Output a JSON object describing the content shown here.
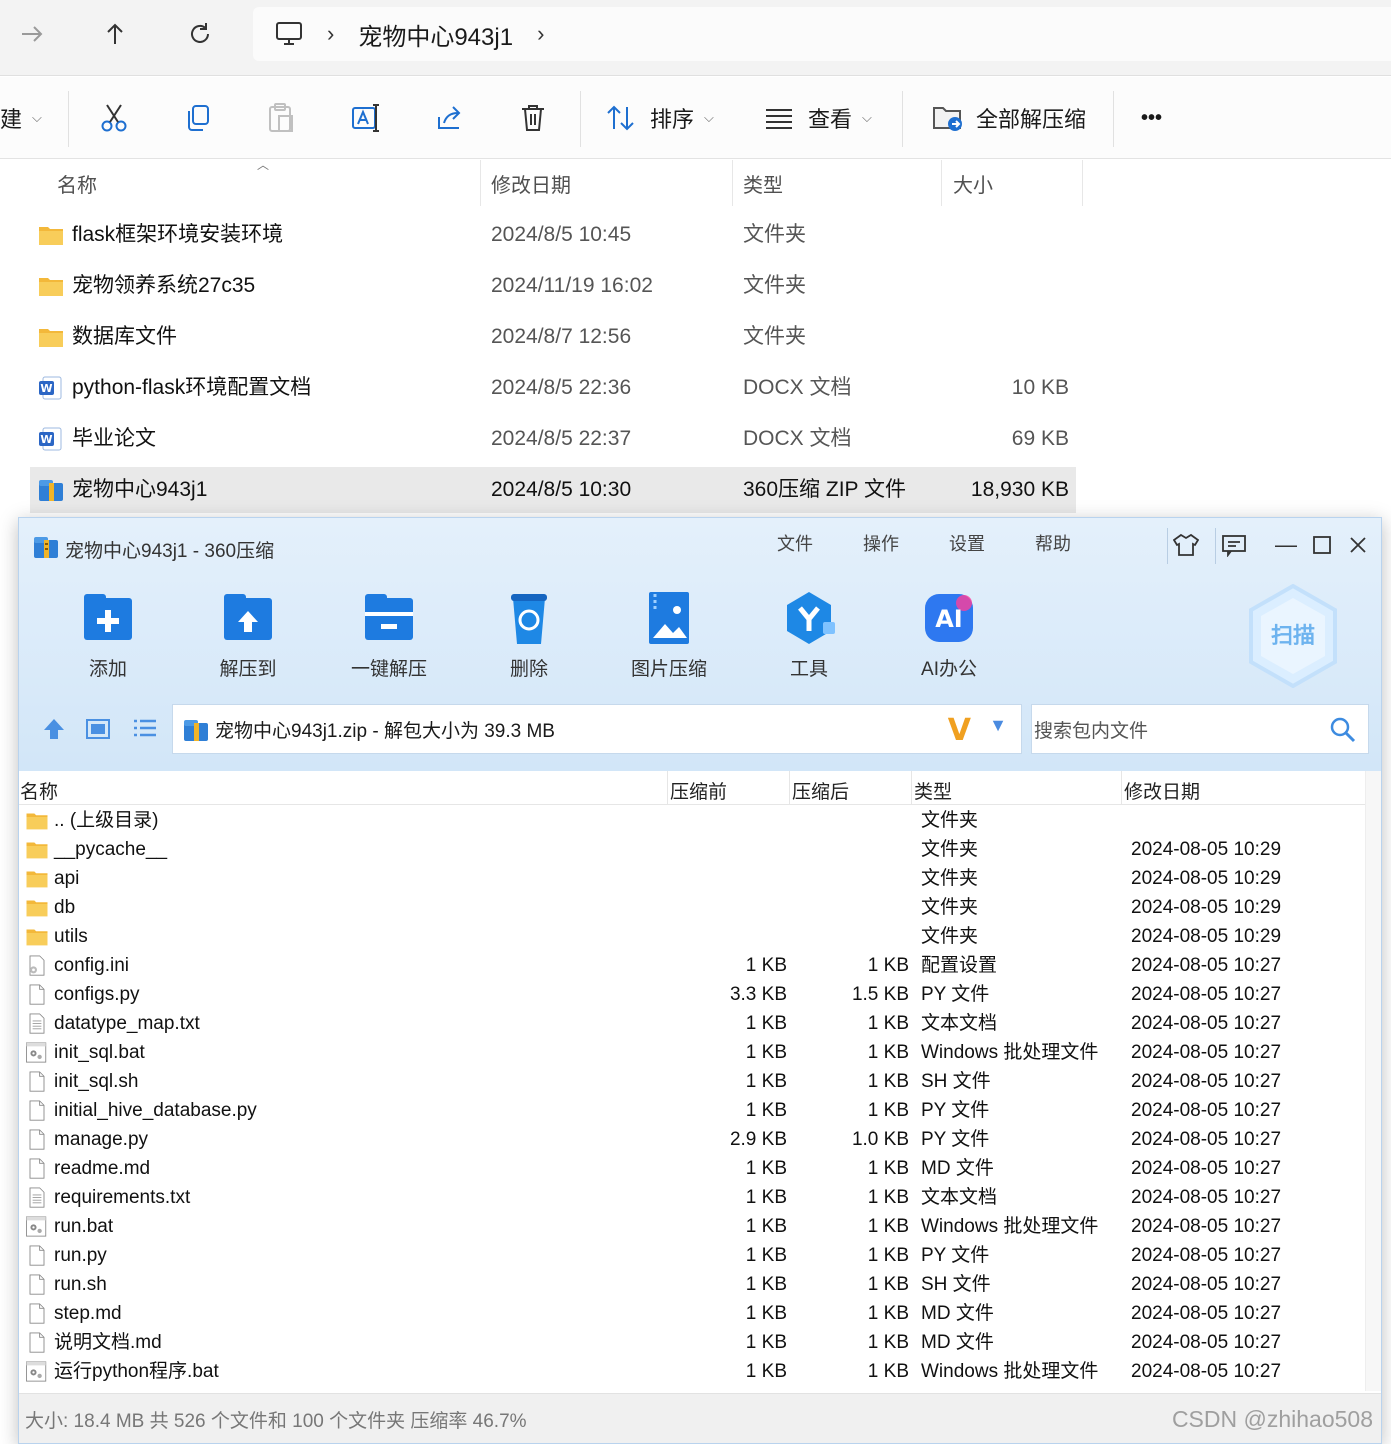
{
  "explorer": {
    "breadcrumb": [
      "宠物中心943j1"
    ],
    "toolbar": {
      "new_label": "建",
      "sort_label": "排序",
      "view_label": "查看",
      "extract_all_label": "全部解压缩",
      "more_label": "•••"
    },
    "columns": {
      "name": "名称",
      "modified": "修改日期",
      "type": "类型",
      "size": "大小"
    },
    "files": [
      {
        "name": "flask框架环境安装环境",
        "modified": "2024/8/5 10:45",
        "type": "文件夹",
        "size": "",
        "icon": "folder-icon"
      },
      {
        "name": "宠物领养系统27c35",
        "modified": "2024/11/19 16:02",
        "type": "文件夹",
        "size": "",
        "icon": "folder-icon"
      },
      {
        "name": "数据库文件",
        "modified": "2024/8/7 12:56",
        "type": "文件夹",
        "size": "",
        "icon": "folder-icon"
      },
      {
        "name": "python-flask环境配置文档",
        "modified": "2024/8/5 22:36",
        "type": "DOCX 文档",
        "size": "10 KB",
        "icon": "word-doc-icon"
      },
      {
        "name": "毕业论文",
        "modified": "2024/8/5 22:37",
        "type": "DOCX 文档",
        "size": "69 KB",
        "icon": "word-doc-icon"
      },
      {
        "name": "宠物中心943j1",
        "modified": "2024/8/5 10:30",
        "type": "360压缩 ZIP 文件",
        "size": "18,930 KB",
        "icon": "zip-archive-icon"
      }
    ]
  },
  "zip": {
    "title": "宠物中心943j1 - 360压缩",
    "menu": [
      "文件",
      "操作",
      "设置",
      "帮助"
    ],
    "tools": [
      {
        "label": "添加",
        "icon": "add-icon"
      },
      {
        "label": "解压到",
        "icon": "extract-to-icon"
      },
      {
        "label": "一键解压",
        "icon": "one-click-extract-icon"
      },
      {
        "label": "删除",
        "icon": "delete-icon"
      },
      {
        "label": "图片压缩",
        "icon": "image-compress-icon"
      },
      {
        "label": "工具",
        "icon": "tools-icon"
      },
      {
        "label": "AI办公",
        "icon": "ai-office-icon"
      }
    ],
    "scan_label": "扫描",
    "path": "宠物中心943j1.zip - 解包大小为 39.3 MB",
    "search_placeholder": "搜索包内文件",
    "columns": {
      "name": "名称",
      "before": "压缩前",
      "after": "压缩后",
      "type": "类型",
      "modified": "修改日期"
    },
    "entries": [
      {
        "name": ".. (上级目录)",
        "before": "",
        "after": "",
        "type": "文件夹",
        "modified": "",
        "icon": "folder-icon"
      },
      {
        "name": "__pycache__",
        "before": "",
        "after": "",
        "type": "文件夹",
        "modified": "2024-08-05 10:29",
        "icon": "folder-icon"
      },
      {
        "name": "api",
        "before": "",
        "after": "",
        "type": "文件夹",
        "modified": "2024-08-05 10:29",
        "icon": "folder-icon"
      },
      {
        "name": "db",
        "before": "",
        "after": "",
        "type": "文件夹",
        "modified": "2024-08-05 10:29",
        "icon": "folder-icon"
      },
      {
        "name": "utils",
        "before": "",
        "after": "",
        "type": "文件夹",
        "modified": "2024-08-05 10:29",
        "icon": "folder-icon"
      },
      {
        "name": "config.ini",
        "before": "1 KB",
        "after": "1 KB",
        "type": "配置设置",
        "modified": "2024-08-05 10:27",
        "icon": "settings-file-icon"
      },
      {
        "name": "configs.py",
        "before": "3.3 KB",
        "after": "1.5 KB",
        "type": "PY 文件",
        "modified": "2024-08-05 10:27",
        "icon": "blank-file-icon"
      },
      {
        "name": "datatype_map.txt",
        "before": "1 KB",
        "after": "1 KB",
        "type": "文本文档",
        "modified": "2024-08-05 10:27",
        "icon": "text-file-icon"
      },
      {
        "name": "init_sql.bat",
        "before": "1 KB",
        "after": "1 KB",
        "type": "Windows 批处理文件",
        "modified": "2024-08-05 10:27",
        "icon": "batch-file-icon"
      },
      {
        "name": "init_sql.sh",
        "before": "1 KB",
        "after": "1 KB",
        "type": "SH 文件",
        "modified": "2024-08-05 10:27",
        "icon": "blank-file-icon"
      },
      {
        "name": "initial_hive_database.py",
        "before": "1 KB",
        "after": "1 KB",
        "type": "PY 文件",
        "modified": "2024-08-05 10:27",
        "icon": "blank-file-icon"
      },
      {
        "name": "manage.py",
        "before": "2.9 KB",
        "after": "1.0 KB",
        "type": "PY 文件",
        "modified": "2024-08-05 10:27",
        "icon": "blank-file-icon"
      },
      {
        "name": "readme.md",
        "before": "1 KB",
        "after": "1 KB",
        "type": "MD 文件",
        "modified": "2024-08-05 10:27",
        "icon": "blank-file-icon"
      },
      {
        "name": "requirements.txt",
        "before": "1 KB",
        "after": "1 KB",
        "type": "文本文档",
        "modified": "2024-08-05 10:27",
        "icon": "text-file-icon"
      },
      {
        "name": "run.bat",
        "before": "1 KB",
        "after": "1 KB",
        "type": "Windows 批处理文件",
        "modified": "2024-08-05 10:27",
        "icon": "batch-file-icon"
      },
      {
        "name": "run.py",
        "before": "1 KB",
        "after": "1 KB",
        "type": "PY 文件",
        "modified": "2024-08-05 10:27",
        "icon": "blank-file-icon"
      },
      {
        "name": "run.sh",
        "before": "1 KB",
        "after": "1 KB",
        "type": "SH 文件",
        "modified": "2024-08-05 10:27",
        "icon": "blank-file-icon"
      },
      {
        "name": "step.md",
        "before": "1 KB",
        "after": "1 KB",
        "type": "MD 文件",
        "modified": "2024-08-05 10:27",
        "icon": "blank-file-icon"
      },
      {
        "name": "说明文档.md",
        "before": "1 KB",
        "after": "1 KB",
        "type": "MD 文件",
        "modified": "2024-08-05 10:27",
        "icon": "blank-file-icon"
      },
      {
        "name": "运行python程序.bat",
        "before": "1 KB",
        "after": "1 KB",
        "type": "Windows 批处理文件",
        "modified": "2024-08-05 10:27",
        "icon": "batch-file-icon"
      }
    ],
    "status": "大小: 18.4 MB 共 526 个文件和 100 个文件夹 压缩率 46.7%",
    "watermark": "CSDN @zhihao508"
  },
  "colors": {
    "accent": "#1e88e5",
    "folder": "#f6c244",
    "zip_header": "#d2e6f8",
    "selection": "#e9e9e9"
  }
}
